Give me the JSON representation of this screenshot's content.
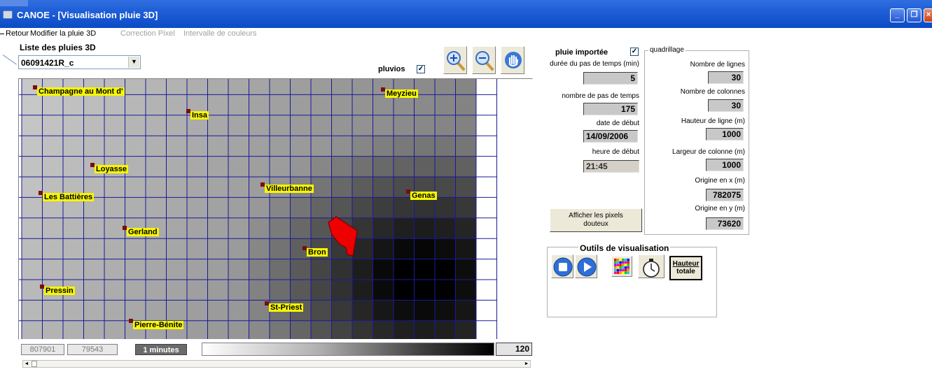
{
  "window": {
    "title": "CANOE  - [Visualisation pluie 3D]"
  },
  "menu": [
    {
      "label": "Retour",
      "enabled": true
    },
    {
      "label": "Modifier la pluie 3D",
      "enabled": true
    },
    {
      "label": "Correction Pixel",
      "enabled": false
    },
    {
      "label": "Intervalle de couleurs",
      "enabled": false
    }
  ],
  "left_panel": {
    "list_label": "Liste des pluies 3D",
    "selected_rain": "06091421R_c",
    "pluvios_label": "pluvios",
    "pluvios_checked": true
  },
  "toolbar": {
    "zoom_in": "zoom-in-icon",
    "zoom_out": "zoom-out-icon",
    "pan": "hand-icon"
  },
  "map": {
    "grid_cols": 23,
    "grid_rows": 13,
    "stations": [
      {
        "name": "Champagne au Mont d'"
      },
      {
        "name": "Meyzieu"
      },
      {
        "name": "Insa"
      },
      {
        "name": "Loyasse"
      },
      {
        "name": "Villeurbanne"
      },
      {
        "name": "Genas"
      },
      {
        "name": "Les Battières"
      },
      {
        "name": "Gerland"
      },
      {
        "name": "Bron"
      },
      {
        "name": "Pressin"
      },
      {
        "name": "St-Priest"
      },
      {
        "name": "Pierre-Bénite"
      }
    ]
  },
  "status": {
    "x_coord": "807901",
    "y_coord": "79543",
    "time_label": "1 minutes",
    "scale_max": "120"
  },
  "right_panel": {
    "pluie_importee_label": "pluie importée",
    "pluie_importee_checked": true,
    "duree_label": "durée du pas de temps (min)",
    "duree_value": "5",
    "nb_pas_label": "nombre de pas de temps",
    "nb_pas_value": "175",
    "date_label": "date de début",
    "date_value": "14/09/2006",
    "heure_label": "heure de début",
    "heure_value": "21:45",
    "afficher_button": "Afficher les pixels douteux",
    "quadrillage": {
      "title": "quadrillage",
      "nb_lignes_label": "Nombre de lignes",
      "nb_lignes_value": "30",
      "nb_colonnes_label": "Nombre de colonnes",
      "nb_colonnes_value": "30",
      "hauteur_ligne_label": "Hauteur de ligne (m)",
      "hauteur_ligne_value": "1000",
      "largeur_col_label": "Largeur de colonne (m)",
      "largeur_col_value": "1000",
      "origine_x_label": "Origine en x (m)",
      "origine_x_value": "782075",
      "origine_y_label": "Origine en y (m)",
      "origine_y_value": "73620"
    },
    "outils": {
      "title": "Outils de visualisation",
      "hauteur_label_1": "Hauteur",
      "hauteur_label_2": "totale"
    }
  }
}
